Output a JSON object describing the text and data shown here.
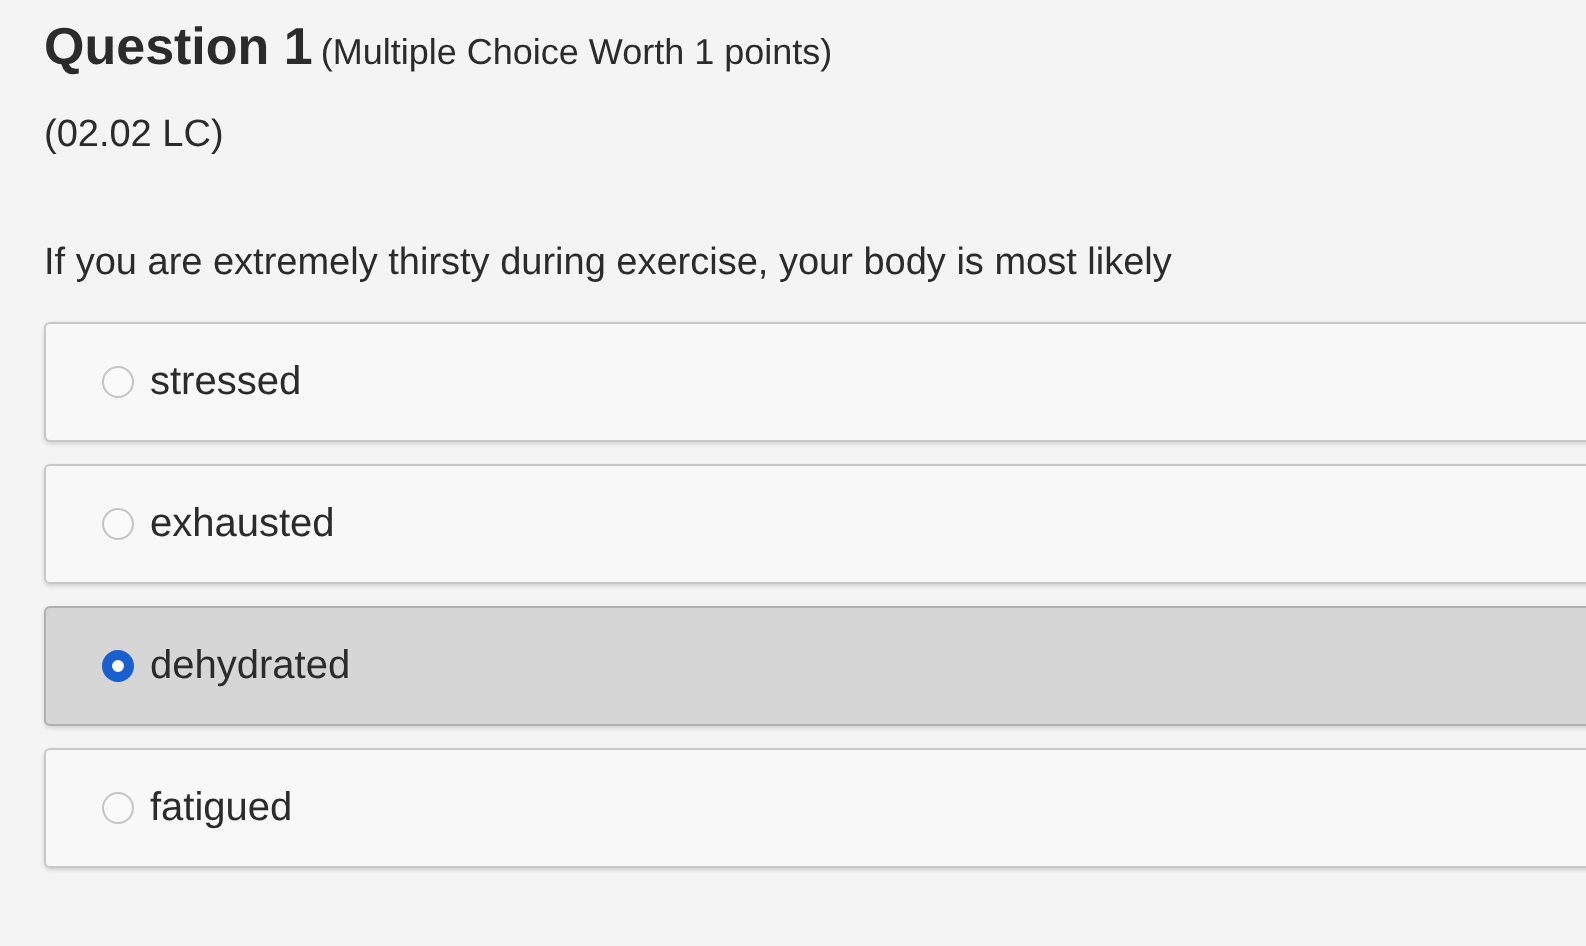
{
  "question": {
    "title": "Question 1",
    "meta": "(Multiple Choice Worth 1 points)",
    "code": "(02.02 LC)",
    "prompt": "If you are extremely thirsty during exercise, your body is most likely"
  },
  "options": [
    {
      "label": "stressed",
      "selected": false
    },
    {
      "label": "exhausted",
      "selected": false
    },
    {
      "label": "dehydrated",
      "selected": true
    },
    {
      "label": "fatigued",
      "selected": false
    }
  ]
}
